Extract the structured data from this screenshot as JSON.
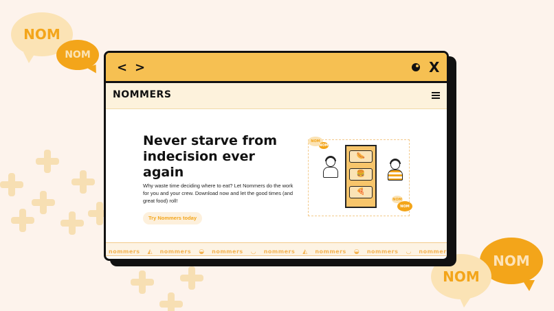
{
  "bubbles": {
    "top_left_big": "NOM",
    "top_left_small": "NOM",
    "bottom_right_back": "NOM",
    "bottom_right_front": "NOM"
  },
  "window": {
    "back_icon": "chevron-left-icon",
    "forward_icon": "chevron-right-icon",
    "close_icon": "close-icon",
    "back_label": "<",
    "forward_label": ">",
    "close_label": "X"
  },
  "navbar": {
    "logo": "NOMMERS",
    "menu_icon": "hamburger-menu-icon"
  },
  "hero": {
    "title": "Never starve from indecision ever again",
    "description": "Why waste time deciding where to eat? Let Nommers do the work for you and your crew. Download now and let the good times (and great food) roll!",
    "cta": "Try Nommers today"
  },
  "illustration": {
    "bubble_1": "NOM",
    "bubble_2": "NOM",
    "bubble_3": "NOM",
    "bubble_4": "NOM"
  },
  "ticker": {
    "items": [
      "nommers",
      "nommers",
      "nommers",
      "nommers",
      "nommers",
      "nommers",
      "nommers"
    ]
  },
  "colors": {
    "background": "#fdf3ec",
    "accent": "#f3a51a",
    "titlebar": "#f6c052",
    "light_accent": "#fbe3b5"
  }
}
